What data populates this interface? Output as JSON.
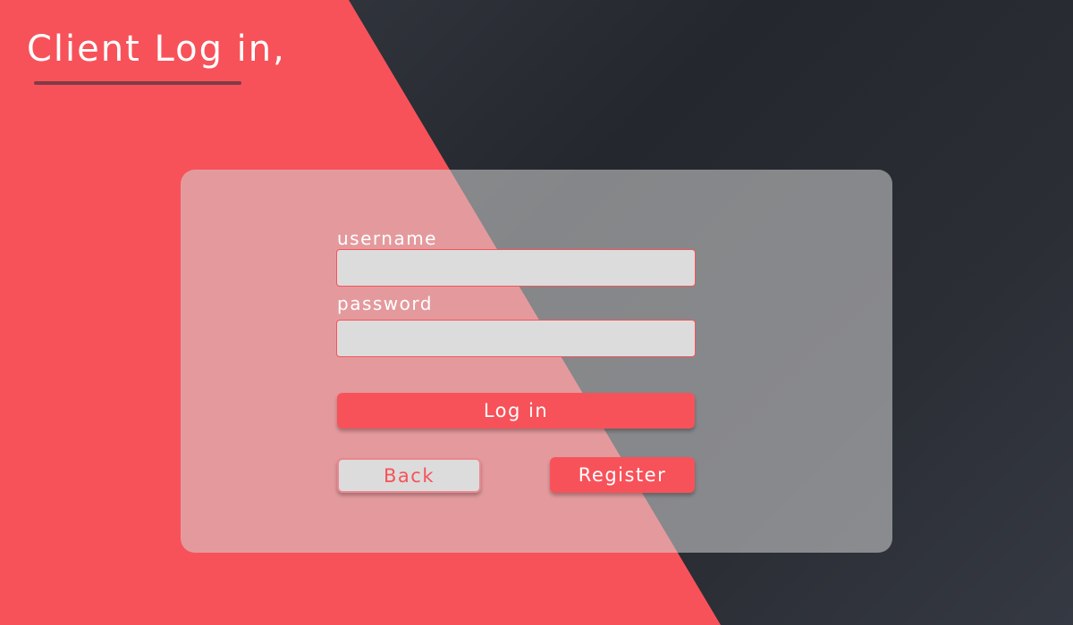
{
  "page": {
    "heading": "Client Log in,"
  },
  "form": {
    "username_label": "username",
    "username_value": "",
    "password_label": "password",
    "password_value": "",
    "login_button": "Log in",
    "back_button": "Back",
    "register_button": "Register"
  },
  "colors": {
    "accent": "#f7525a",
    "dark_background": "#2b2e35",
    "panel": "#d6d6d6",
    "input_background": "#dcdcdc",
    "heading_underline": "#7e3b46"
  }
}
